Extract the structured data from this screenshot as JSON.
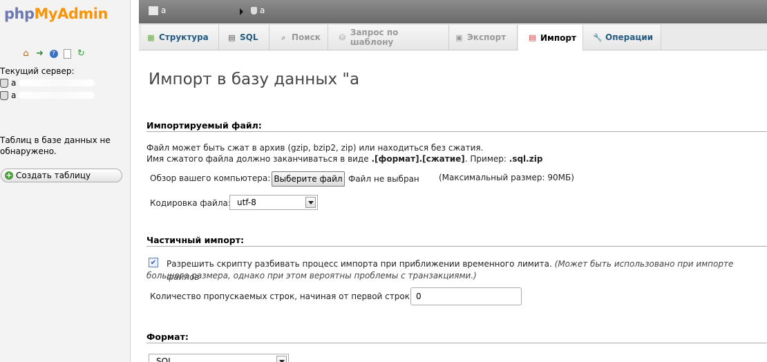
{
  "navigation": {
    "logo_php": "php",
    "logo_myadmin": "MyAdmin",
    "icons": [
      "home-icon",
      "exit-icon",
      "help-icon",
      "docs-icon",
      "reload-icon"
    ],
    "current_server_label": "Текущий сервер:",
    "db_items": [
      "a",
      "a"
    ],
    "no_tables_text": "Таблиц в базе данных не обнаружено.",
    "create_table_label": "Создать таблицу"
  },
  "breadcrumb": {
    "server": "a",
    "database": "a"
  },
  "tabs": [
    {
      "label": "Структура",
      "icon": "structure-icon",
      "state": "normal"
    },
    {
      "label": "SQL",
      "icon": "sql-icon",
      "state": "normal"
    },
    {
      "label": "Поиск",
      "icon": "search-icon",
      "state": "disabled"
    },
    {
      "label": "Запрос по шаблону",
      "icon": "query-icon",
      "state": "disabled"
    },
    {
      "label": "Экспорт",
      "icon": "export-icon",
      "state": "disabled"
    },
    {
      "label": "Импорт",
      "icon": "import-icon",
      "state": "active"
    },
    {
      "label": "Операции",
      "icon": "wrench-icon",
      "state": "normal"
    }
  ],
  "page_title": "Импорт в базу данных \"a",
  "file_section": {
    "heading": "Импортируемый файл:",
    "note_line1": "Файл может быть сжат в архив (gzip, bzip2, zip) или находиться без сжатия.",
    "note_line2_prefix": "Имя сжатого файла должно заканчиваться в виде",
    "note_line2_format": ".[формат].[сжатие]",
    "note_line2_example_label": ". Пример:",
    "note_line2_example": ".sql.zip",
    "browse_label": "Обзор вашего компьютера:",
    "choose_file_button": "Выберите файл",
    "no_file_text": "Файл не выбран",
    "max_size_text": "(Максимальный размер: 90МБ)",
    "charset_label": "Кодировка файла:",
    "charset_value": "utf-8"
  },
  "partial_section": {
    "heading": "Частичный импорт:",
    "checkbox_checked": true,
    "checkbox_label": "Разрешить скрипту разбивать процесс импорта при приближении временного лимита.",
    "checkbox_note_line1": "(Может быть использовано при импорте файлов",
    "checkbox_note_line2": "большого размера, однако при этом вероятны проблемы с транзакциями.)",
    "skip_label": "Количество пропускаемых строк, начиная от первой строки:",
    "skip_value": "0"
  },
  "format_section": {
    "heading": "Формат:",
    "format_value": "SQL"
  }
}
